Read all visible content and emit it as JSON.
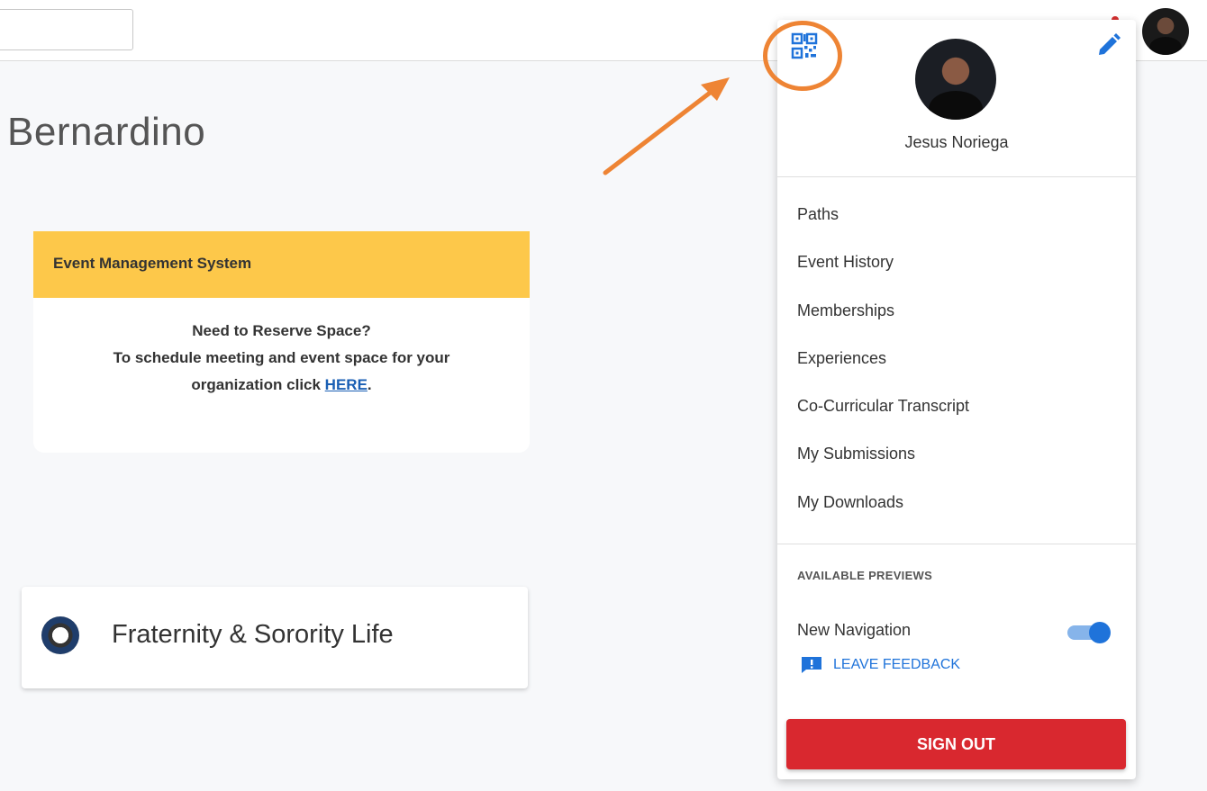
{
  "page": {
    "title": "Bernardino"
  },
  "event_card": {
    "header": "Event Management System",
    "line1": "Need to Reserve Space?",
    "line2": "To schedule meeting and event space for your",
    "line3_prefix": "organization click ",
    "link": "HERE",
    "line3_suffix": "."
  },
  "org_card": {
    "name": "Fraternity & Sorority Life"
  },
  "menu": {
    "username": "Jesus Noriega",
    "items": [
      {
        "label": "Paths"
      },
      {
        "label": "Event History"
      },
      {
        "label": "Memberships"
      },
      {
        "label": "Experiences"
      },
      {
        "label": "Co-Curricular Transcript"
      },
      {
        "label": "My Submissions"
      },
      {
        "label": "My Downloads"
      }
    ],
    "previews_label": "AVAILABLE PREVIEWS",
    "new_navigation_label": "New Navigation",
    "new_navigation_enabled": true,
    "feedback_label": "LEAVE FEEDBACK",
    "signout_label": "SIGN OUT",
    "icons": [
      "qr-code-icon",
      "edit-pencil-icon",
      "feedback-icon"
    ]
  },
  "colors": {
    "accent": "#1f73da",
    "banner": "#fdc84a",
    "signout": "#d9282f",
    "annotation": "#ee8434"
  }
}
